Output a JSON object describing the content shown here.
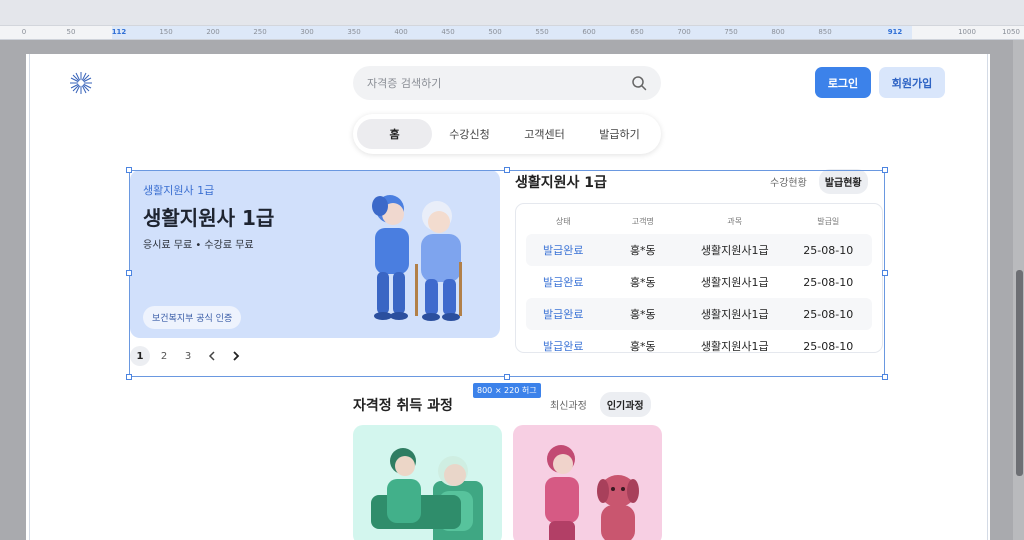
{
  "ruler": {
    "labels": [
      "0",
      "50",
      "112",
      "150",
      "200",
      "250",
      "300",
      "350",
      "400",
      "450",
      "500",
      "550",
      "600",
      "650",
      "700",
      "750",
      "800",
      "850",
      "912",
      "1000",
      "1050"
    ],
    "size_tag": "800 × 220 허그"
  },
  "header": {
    "search_placeholder": "자격증 검색하기",
    "login_label": "로그인",
    "signup_label": "회원가입"
  },
  "nav": {
    "tabs": [
      {
        "label": "홈",
        "active": true
      },
      {
        "label": "수강신청",
        "active": false
      },
      {
        "label": "고객센터",
        "active": false
      },
      {
        "label": "발급하기",
        "active": false
      }
    ]
  },
  "banner": {
    "kicker": "생활지원사 1급",
    "title": "생활지원사 1급",
    "subtitle": "응시료 무료 • 수강료 무료",
    "badge": "보건복지부 공식 인증",
    "pager": [
      "1",
      "2",
      "3"
    ],
    "active_page": "1"
  },
  "status_panel": {
    "title": "생활지원사 1급",
    "tabs": [
      {
        "label": "수강현황",
        "active": false
      },
      {
        "label": "발급현황",
        "active": true
      }
    ],
    "columns": [
      "상태",
      "고객명",
      "과목",
      "발급일"
    ],
    "rows": [
      [
        "발급완료",
        "홍*동",
        "생활지원사1급",
        "25-08-10"
      ],
      [
        "발급완료",
        "홍*동",
        "생활지원사1급",
        "25-08-10"
      ],
      [
        "발급완료",
        "홍*동",
        "생활지원사1급",
        "25-08-10"
      ],
      [
        "발급완료",
        "홍*동",
        "생활지원사1급",
        "25-08-10"
      ]
    ]
  },
  "courses": {
    "title": "자격정 취득 과정",
    "tabs": [
      {
        "label": "최신과정",
        "active": false
      },
      {
        "label": "인기과정",
        "active": true
      }
    ]
  },
  "colors": {
    "accent": "#3c82ea",
    "accent_light": "#d9e6fb",
    "banner_bg": "#d1e0fb",
    "card_teal": "#d3f6ee",
    "card_pink": "#f7cfe3"
  }
}
